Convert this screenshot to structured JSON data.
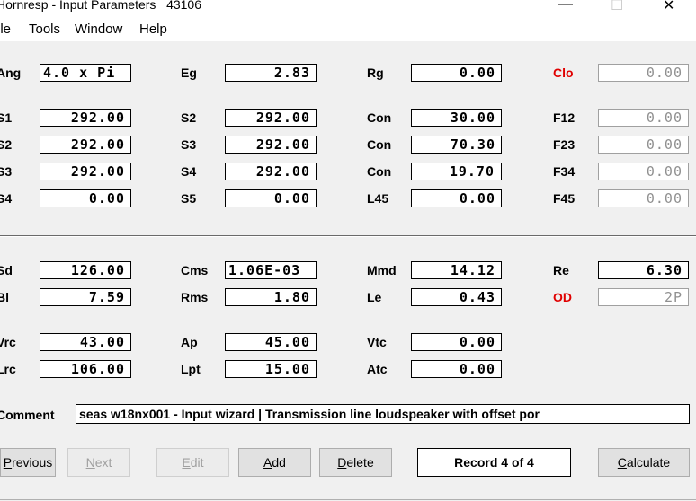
{
  "window": {
    "title": "Hornresp - Input Parameters",
    "record_id": "43106",
    "minimize": "—",
    "maximize": "☐",
    "close": "✕"
  },
  "menu": [
    "ile",
    "Tools",
    "Window",
    "Help"
  ],
  "fields": {
    "ang": {
      "label": "Ang",
      "value": "4.0 x Pi"
    },
    "eg": {
      "label": "Eg",
      "value": "2.83"
    },
    "rg": {
      "label": "Rg",
      "value": "0.00"
    },
    "clo": {
      "label": "Clo",
      "value": "0.00"
    },
    "s1": {
      "label": "S1",
      "value": "292.00"
    },
    "s2a": {
      "label": "S2",
      "value": "292.00"
    },
    "con1": {
      "label": "Con",
      "value": "30.00"
    },
    "f12": {
      "label": "F12",
      "value": "0.00"
    },
    "s2b": {
      "label": "S2",
      "value": "292.00"
    },
    "s3a": {
      "label": "S3",
      "value": "292.00"
    },
    "con2": {
      "label": "Con",
      "value": "70.30"
    },
    "f23": {
      "label": "F23",
      "value": "0.00"
    },
    "s3b": {
      "label": "S3",
      "value": "292.00"
    },
    "s4a": {
      "label": "S4",
      "value": "292.00"
    },
    "con3": {
      "label": "Con",
      "value": "19.70"
    },
    "f34": {
      "label": "F34",
      "value": "0.00"
    },
    "s4b": {
      "label": "S4",
      "value": "0.00"
    },
    "s5": {
      "label": "S5",
      "value": "0.00"
    },
    "l45": {
      "label": "L45",
      "value": "0.00"
    },
    "f45": {
      "label": "F45",
      "value": "0.00"
    },
    "sd": {
      "label": "Sd",
      "value": "126.00"
    },
    "cms": {
      "label": "Cms",
      "value": "1.06E-03"
    },
    "mmd": {
      "label": "Mmd",
      "value": "14.12"
    },
    "re": {
      "label": "Re",
      "value": "6.30"
    },
    "bl": {
      "label": "Bl",
      "value": "7.59"
    },
    "rms": {
      "label": "Rms",
      "value": "1.80"
    },
    "le": {
      "label": "Le",
      "value": "0.43"
    },
    "od": {
      "label": "OD",
      "value": "2P"
    },
    "vrc": {
      "label": "Vrc",
      "value": "43.00"
    },
    "ap": {
      "label": "Ap",
      "value": "45.00"
    },
    "vtc": {
      "label": "Vtc",
      "value": "0.00"
    },
    "lrc": {
      "label": "Lrc",
      "value": "106.00"
    },
    "lpt": {
      "label": "Lpt",
      "value": "15.00"
    },
    "atc": {
      "label": "Atc",
      "value": "0.00"
    }
  },
  "comment": {
    "label": "Comment",
    "value": "seas w18nx001 - Input wizard | Transmission line loudspeaker with offset por"
  },
  "buttons": {
    "previous": {
      "first": "P",
      "rest": "revious"
    },
    "next": {
      "first": "N",
      "rest": "ext"
    },
    "edit": {
      "first": "E",
      "rest": "dit"
    },
    "add": {
      "first": "A",
      "rest": "dd"
    },
    "delete": {
      "first": "D",
      "rest": "elete"
    },
    "calculate": {
      "first": "C",
      "rest": "alculate"
    }
  },
  "record_status": "Record 4 of 4",
  "colors": {
    "accent_red": "#e00000",
    "readonly_gray": "#909090"
  }
}
